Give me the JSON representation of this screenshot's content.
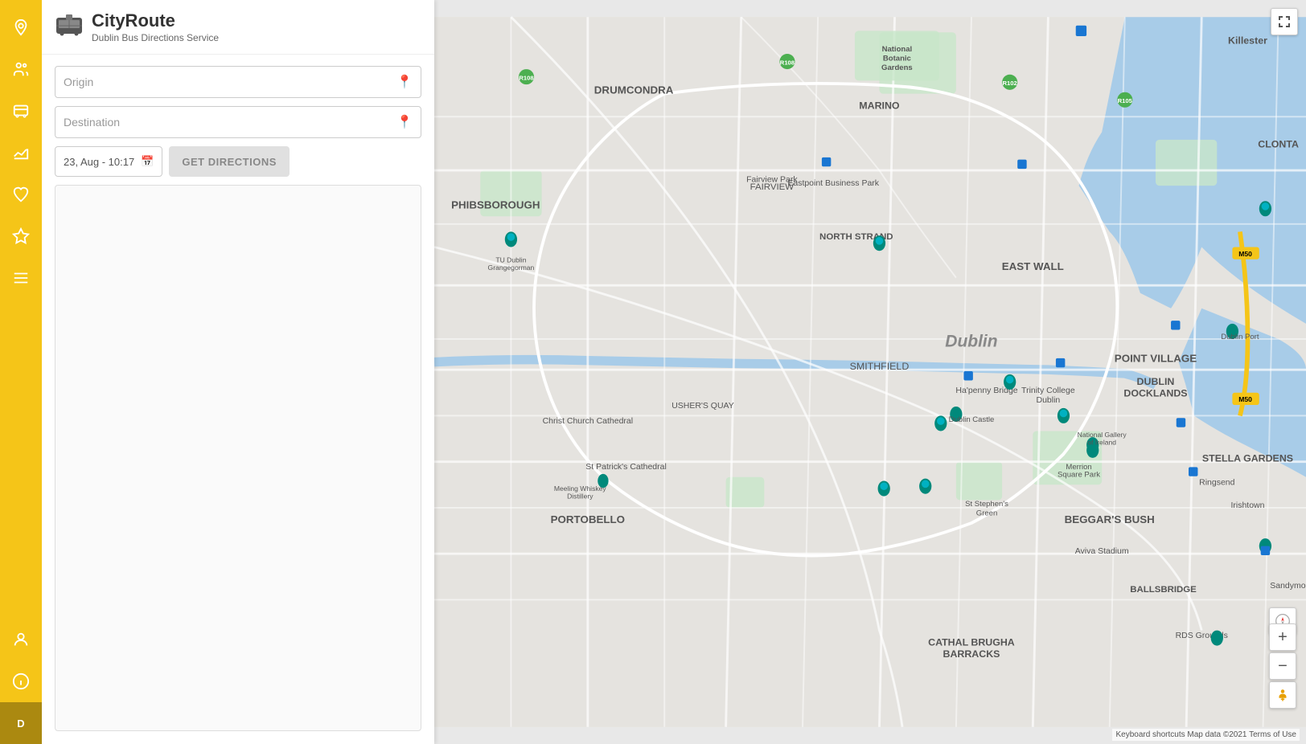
{
  "app": {
    "title": "CityRoute",
    "subtitle": "Dublin Bus Directions Service",
    "logo_icon": "🚌"
  },
  "sidebar": {
    "items": [
      {
        "id": "map",
        "icon": "map-pin",
        "label": "Map",
        "active": false
      },
      {
        "id": "people",
        "icon": "people",
        "label": "People",
        "active": false
      },
      {
        "id": "bus",
        "icon": "bus",
        "label": "Bus",
        "active": false
      },
      {
        "id": "chart",
        "icon": "chart",
        "label": "Chart",
        "active": false
      },
      {
        "id": "heart",
        "icon": "heart",
        "label": "Favorites",
        "active": false
      },
      {
        "id": "star",
        "icon": "star",
        "label": "Starred",
        "active": false
      },
      {
        "id": "list",
        "icon": "list",
        "label": "List",
        "active": false
      },
      {
        "id": "person",
        "icon": "person",
        "label": "Account",
        "active": false
      },
      {
        "id": "info",
        "icon": "info",
        "label": "Info",
        "active": false
      }
    ],
    "bottom_item": {
      "id": "settings",
      "icon": "settings",
      "label": "D"
    }
  },
  "form": {
    "origin_placeholder": "Origin",
    "destination_placeholder": "Destination",
    "datetime_value": "23, Aug - 10:17",
    "get_directions_label": "GET DIRECTIONS"
  },
  "map": {
    "attribution": "Keyboard shortcuts   Map data ©2021   Terms of Use"
  },
  "colors": {
    "sidebar_bg": "#f5c518",
    "button_disabled": "#e0e0e0",
    "accent": "#1976d2"
  }
}
